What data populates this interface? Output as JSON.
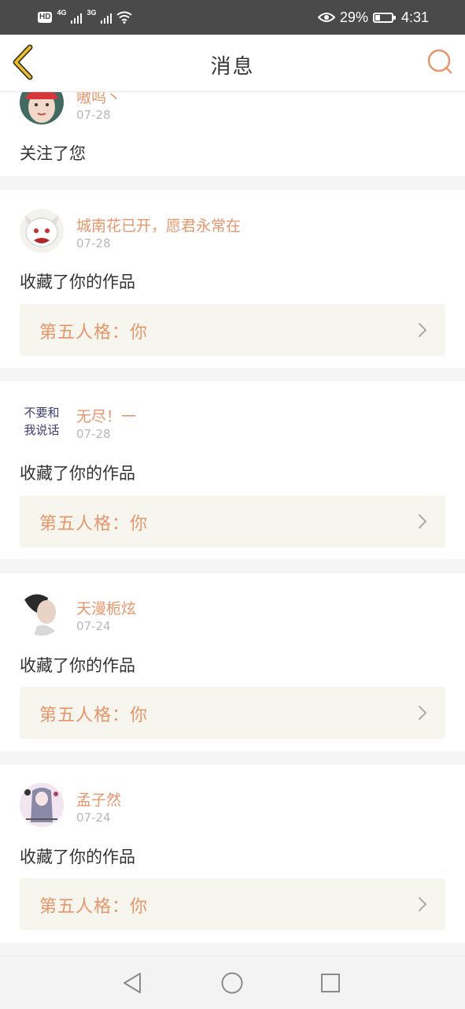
{
  "status_bar": {
    "hd": "HD",
    "net1": "4G",
    "net2": "3G",
    "battery_percent": "29%",
    "battery_level": 0.29,
    "time": "4:31"
  },
  "header": {
    "title": "消息",
    "back_icon": "chevron-left-icon",
    "search_icon": "search-icon"
  },
  "notifications": [
    {
      "username": "嗷呜丶",
      "date": "07-28",
      "action": "关注了您",
      "work": null
    },
    {
      "username": "城南花已开，愿君永常在",
      "date": "07-28",
      "action": "收藏了你的作品",
      "work": "第五人格：你"
    },
    {
      "username": "无尽！一",
      "date": "07-28",
      "action": "收藏了你的作品",
      "work": "第五人格：你",
      "avatar_text": [
        "不要和",
        "我说话"
      ]
    },
    {
      "username": "天漫栀炫",
      "date": "07-24",
      "action": "收藏了你的作品",
      "work": "第五人格：你"
    },
    {
      "username": "孟子然",
      "date": "07-24",
      "action": "收藏了你的作品",
      "work": "第五人格：你"
    }
  ],
  "colors": {
    "accent": "#e8956a",
    "back_icon": "#f0c020",
    "work_bg": "#f6f5ee"
  },
  "nav_bar": {
    "icons": [
      "back-triangle-icon",
      "home-circle-icon",
      "recents-square-icon"
    ]
  }
}
